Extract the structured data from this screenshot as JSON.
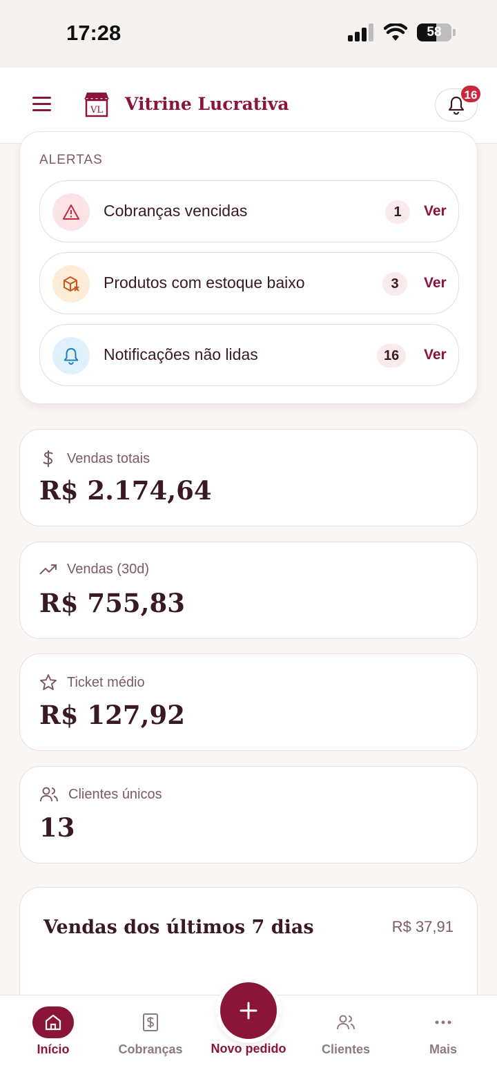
{
  "status_bar": {
    "time": "17:28",
    "battery": "58"
  },
  "header": {
    "brand": "Vitrine Lucrativa",
    "notification_count": "16",
    "logo_text": "VL"
  },
  "alerts": {
    "title": "ALERTAS",
    "items": [
      {
        "label": "Cobranças vencidas",
        "count": "1",
        "action": "Ver",
        "icon": "warning-icon"
      },
      {
        "label": "Produtos com estoque baixo",
        "count": "3",
        "action": "Ver",
        "icon": "box-icon"
      },
      {
        "label": "Notificações não lidas",
        "count": "16",
        "action": "Ver",
        "icon": "bell-icon"
      }
    ]
  },
  "stats": [
    {
      "label": "Vendas totais",
      "value": "R$ 2.174,64",
      "icon": "dollar-icon"
    },
    {
      "label": "Vendas (30d)",
      "value": "R$ 755,83",
      "icon": "trending-up-icon"
    },
    {
      "label": "Ticket médio",
      "value": "R$ 127,92",
      "icon": "star-icon"
    },
    {
      "label": "Clientes únicos",
      "value": "13",
      "icon": "users-icon"
    }
  ],
  "chart_card": {
    "title": "Vendas dos últimos 7 dias",
    "total": "R$ 37,91"
  },
  "nav": {
    "items": [
      {
        "label": "Início",
        "icon": "home-icon"
      },
      {
        "label": "Cobranças",
        "icon": "receipt-icon"
      },
      {
        "label": "Novo pedido",
        "icon": "plus-icon"
      },
      {
        "label": "Clientes",
        "icon": "users-icon"
      },
      {
        "label": "Mais",
        "icon": "more-icon"
      }
    ]
  },
  "colors": {
    "accent": "#8b1538",
    "background": "#faf6f3",
    "text": "#3a1a22",
    "muted": "#7d5a62"
  }
}
